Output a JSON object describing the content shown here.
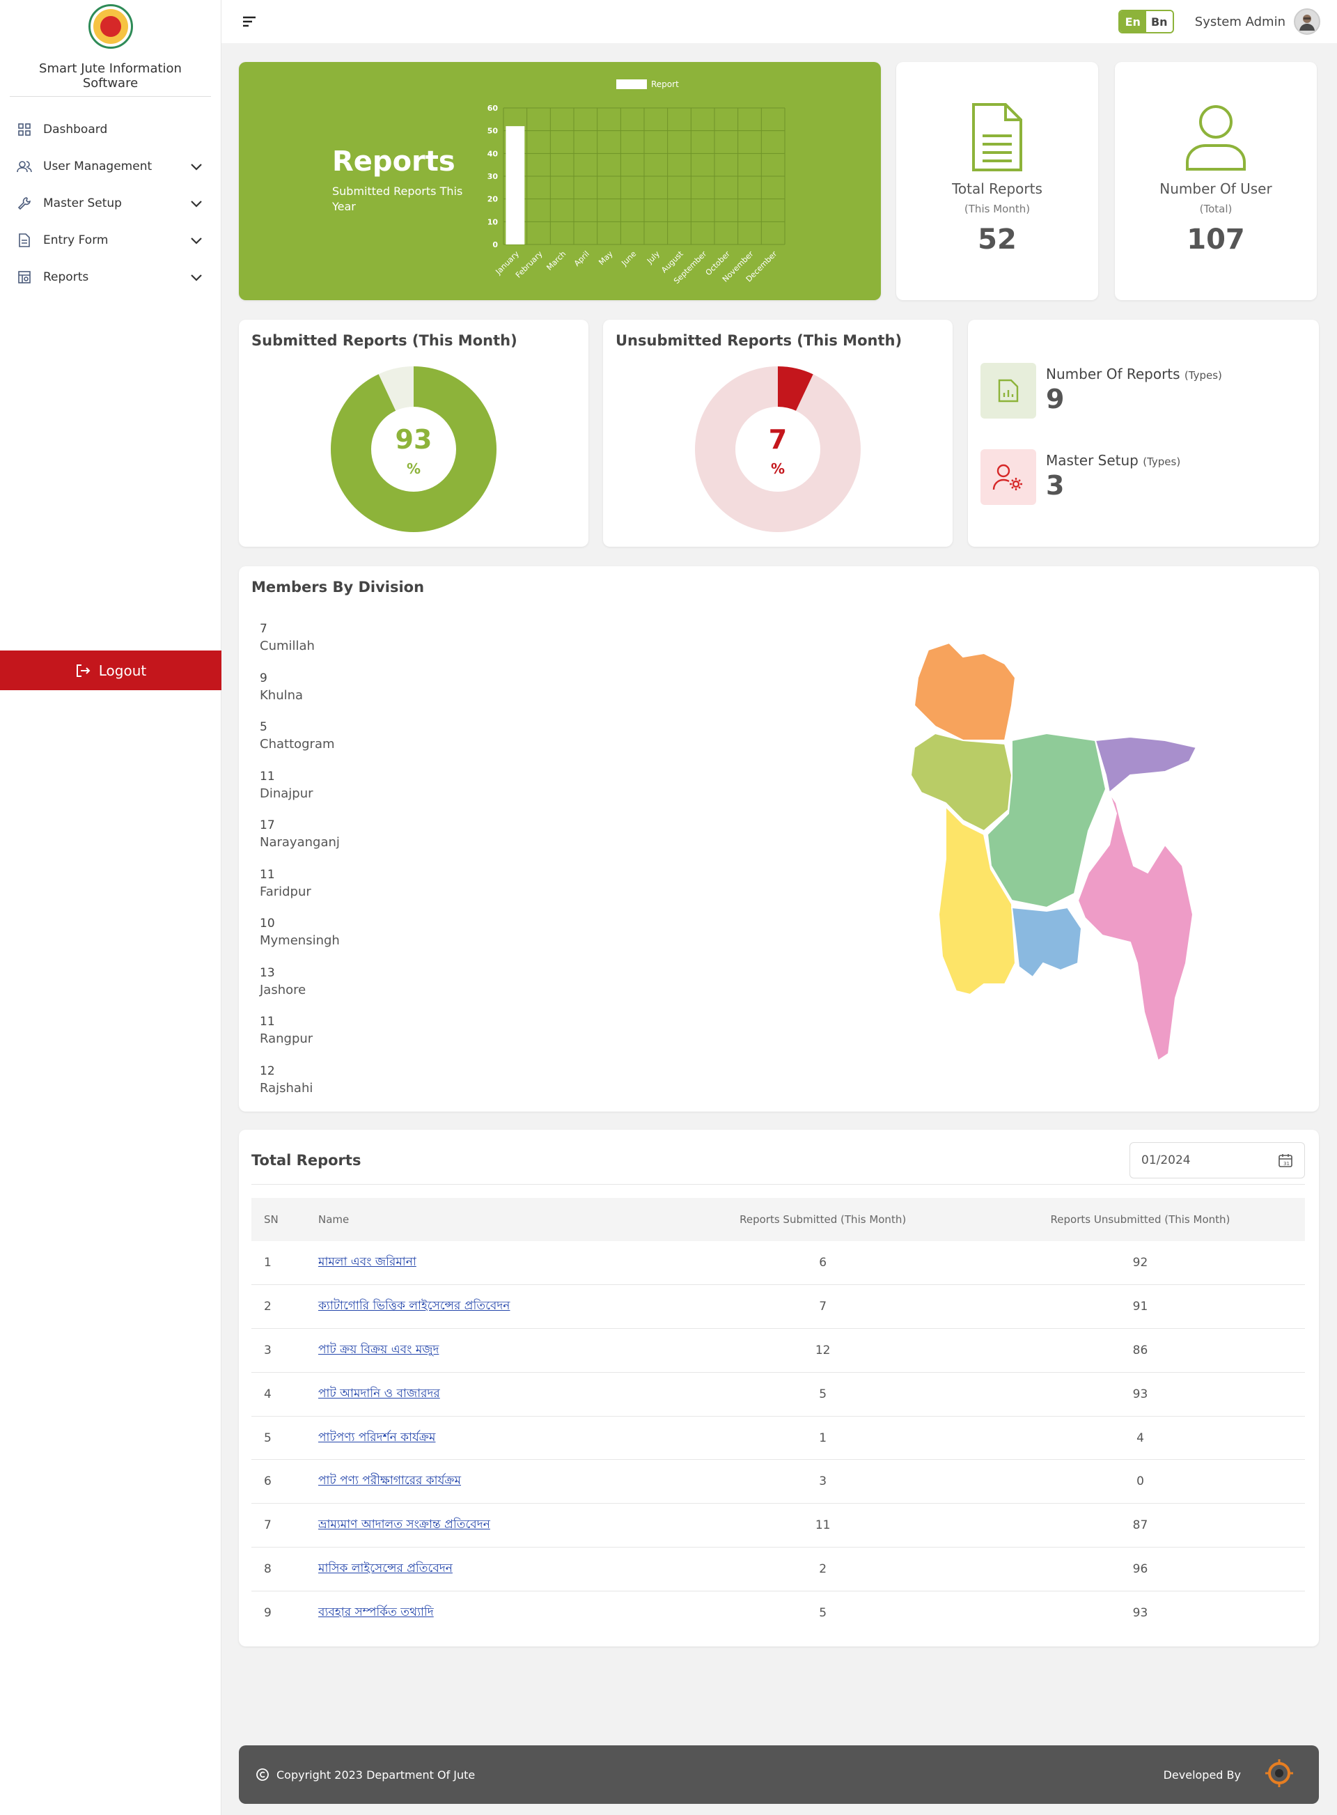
{
  "sidebar": {
    "app_name": "Smart Jute Information Software",
    "items": [
      {
        "label": "Dashboard"
      },
      {
        "label": "User Management"
      },
      {
        "label": "Master Setup"
      },
      {
        "label": "Entry Form"
      },
      {
        "label": "Reports"
      }
    ],
    "logout_label": "Logout"
  },
  "topbar": {
    "lang_en": "En",
    "lang_bn": "Bn",
    "user_name": "System Admin"
  },
  "report_card": {
    "title": "Reports",
    "subtitle": "Submitted Reports This Year"
  },
  "chart_data": {
    "type": "bar",
    "categories": [
      "January",
      "February",
      "March",
      "April",
      "May",
      "June",
      "July",
      "August",
      "September",
      "October",
      "November",
      "December"
    ],
    "series": [
      {
        "name": "Report",
        "values": [
          52,
          0,
          0,
          0,
          0,
          0,
          0,
          0,
          0,
          0,
          0,
          0
        ]
      }
    ],
    "ylim": [
      0,
      60
    ],
    "yticks": [
      0,
      10,
      20,
      30,
      40,
      50,
      60
    ],
    "grid": true,
    "legend": "top"
  },
  "stats": {
    "total_reports": {
      "label": "Total Reports",
      "sub": "(This Month)",
      "value": "52"
    },
    "number_of_user": {
      "label": "Number Of User",
      "sub": "(Total)",
      "value": "107"
    }
  },
  "submitted": {
    "title": "Submitted Reports (This Month)",
    "value": "93",
    "pct": "%",
    "fraction": 0.93
  },
  "unsubmitted": {
    "title": "Unsubmitted Reports (This Month)",
    "value": "7",
    "pct": "%",
    "fraction": 0.07
  },
  "types": {
    "reports": {
      "label": "Number Of Reports",
      "qualifier": "(Types)",
      "value": "9"
    },
    "master": {
      "label": "Master Setup",
      "qualifier": "(Types)",
      "value": "3"
    }
  },
  "members": {
    "title": "Members By Division",
    "divisions": [
      {
        "count": "7",
        "name": "Cumillah"
      },
      {
        "count": "9",
        "name": "Khulna"
      },
      {
        "count": "5",
        "name": "Chattogram"
      },
      {
        "count": "11",
        "name": "Dinajpur"
      },
      {
        "count": "17",
        "name": "Narayanganj"
      },
      {
        "count": "11",
        "name": "Faridpur"
      },
      {
        "count": "10",
        "name": "Mymensingh"
      },
      {
        "count": "13",
        "name": "Jashore"
      },
      {
        "count": "11",
        "name": "Rangpur"
      },
      {
        "count": "12",
        "name": "Rajshahi"
      }
    ]
  },
  "table": {
    "title": "Total Reports",
    "month_value": "01/2024",
    "headers": {
      "sn": "SN",
      "name": "Name",
      "submitted": "Reports Submitted (This Month)",
      "unsubmitted": "Reports Unsubmitted (This Month)"
    },
    "rows": [
      {
        "sn": "1",
        "name": "মামলা এবং জরিমানা",
        "submitted": "6",
        "unsubmitted": "92"
      },
      {
        "sn": "2",
        "name": "ক্যাটাগোরি ভিত্তিক লাইসেন্সের প্রতিবেদন",
        "submitted": "7",
        "unsubmitted": "91"
      },
      {
        "sn": "3",
        "name": "পাট ক্রয় বিক্রয় এবং মজুদ",
        "submitted": "12",
        "unsubmitted": "86"
      },
      {
        "sn": "4",
        "name": "পাট আমদানি ও বাজারদর",
        "submitted": "5",
        "unsubmitted": "93"
      },
      {
        "sn": "5",
        "name": "পাটপণ্য পরিদর্শন কার্যক্রম",
        "submitted": "1",
        "unsubmitted": "4"
      },
      {
        "sn": "6",
        "name": "পাট পণ্য পরীক্ষাগারের কার্যক্রম",
        "submitted": "3",
        "unsubmitted": "0"
      },
      {
        "sn": "7",
        "name": "ভ্রাম্যমাণ আদালত সংক্রান্ত প্রতিবেদন",
        "submitted": "11",
        "unsubmitted": "87"
      },
      {
        "sn": "8",
        "name": "মাসিক লাইসেন্সের প্রতিবেদন",
        "submitted": "2",
        "unsubmitted": "96"
      },
      {
        "sn": "9",
        "name": "ব্যবহার সম্পর্কিত তথ্যাদি",
        "submitted": "5",
        "unsubmitted": "93"
      }
    ]
  },
  "footer": {
    "copyright": "Copyright 2023 Department Of Jute",
    "developed_by": "Developed By"
  },
  "colors": {
    "brand_green": "#8db33a",
    "danger_red": "#c4161c",
    "donut_green_light": "#eef1e6",
    "donut_red_light": "#f3dcdd"
  }
}
